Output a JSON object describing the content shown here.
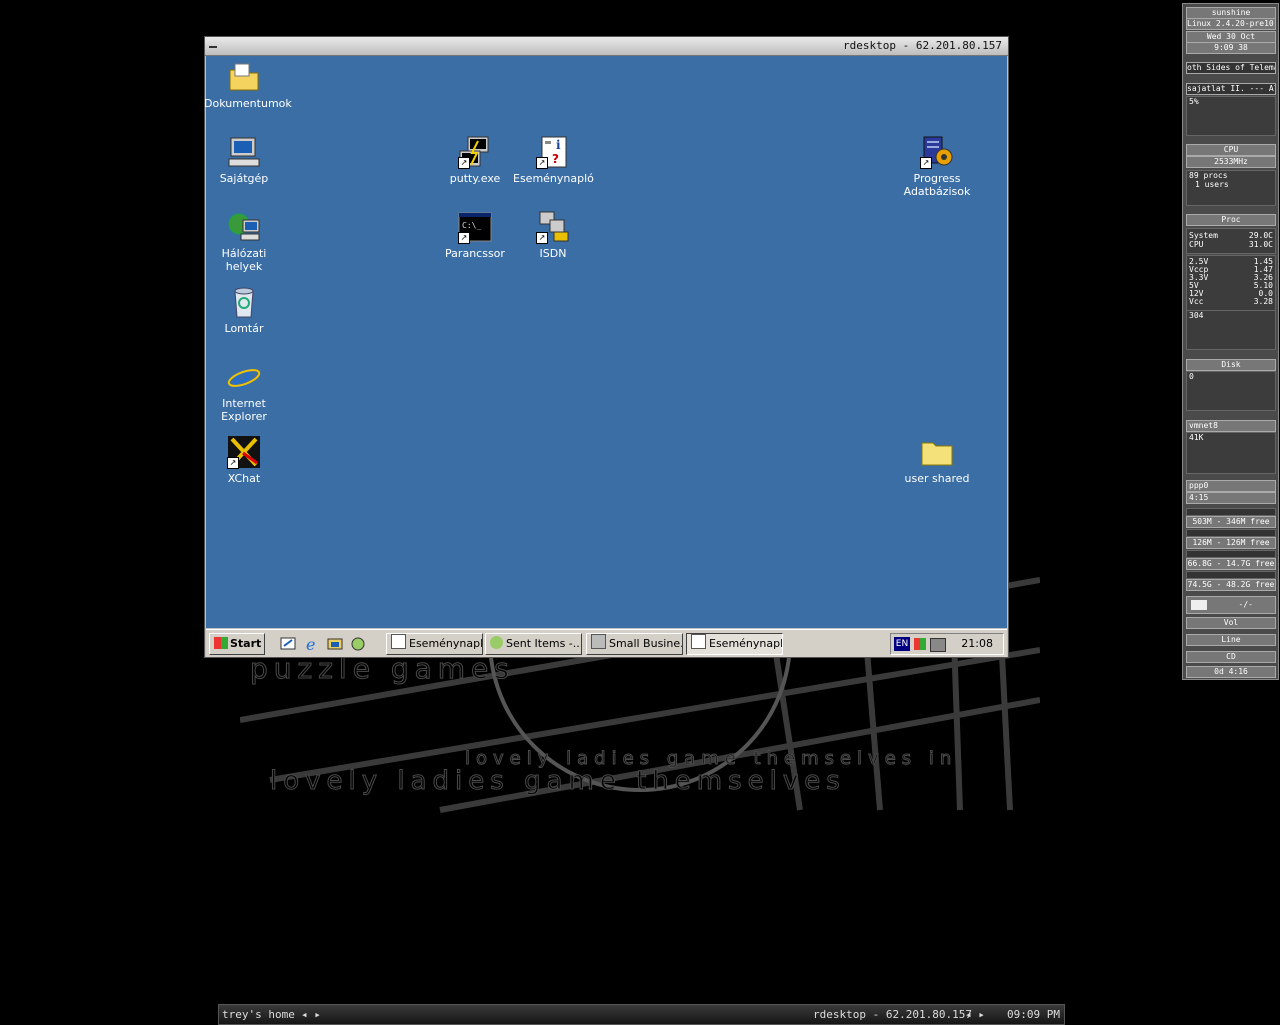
{
  "window": {
    "title": "rdesktop - 62.201.80.157"
  },
  "desktop_icons": [
    {
      "label": "Dokumentumok"
    },
    {
      "label": "Sajátgép"
    },
    {
      "label": "Hálózati helyek"
    },
    {
      "label": "Lomtár"
    },
    {
      "label": "Internet Explorer"
    },
    {
      "label": "XChat"
    },
    {
      "label": "putty.exe"
    },
    {
      "label": "Eseménynapló"
    },
    {
      "label": "Parancssor"
    },
    {
      "label": "ISDN"
    },
    {
      "label": "Progress Adatbázisok"
    },
    {
      "label": "user shared"
    }
  ],
  "taskbar": {
    "start_label": "Start",
    "tasks": [
      "Eseménynapló",
      "Sent Items -...",
      "Small Busine...",
      "Eseménynapló"
    ],
    "lang": "EN",
    "clock": "21:08"
  },
  "gkrellm": {
    "host": "sunshine",
    "kernel": "Linux 2.4.20-pre10-ac",
    "date": "Wed 30 Oct",
    "time": "9:09 38",
    "track1": "oth Sides of Telemarke",
    "track2": "sajatlat II. --- Allasajan",
    "cpu_pct": "5%",
    "cpu_label": "CPU",
    "cpu_mhz": "2533MHz",
    "procs": "89 procs",
    "users": "1 users",
    "proc_label": "Proc",
    "temps": [
      [
        "System",
        "29.0C"
      ],
      [
        "CPU",
        "31.0C"
      ]
    ],
    "volts": [
      [
        "2.5V",
        "1.45"
      ],
      [
        "Vccp",
        "1.47"
      ],
      [
        "3.3V",
        "3.26"
      ],
      [
        "5V",
        "5.10"
      ],
      [
        "12V",
        "0.0"
      ],
      [
        "Vcc",
        "3.28"
      ]
    ],
    "disk_val": "304",
    "disk_label": "Disk",
    "disk_zero": "0",
    "net1": "vmnet8",
    "net_val": "41K",
    "net2": "ppp0",
    "uptime_small": "4:15",
    "mem1": "503M - 346M free",
    "mem2": "126M - 126M free",
    "fs1": "66.8G - 14.7G free",
    "fs2": "74.5G - 48.2G free",
    "mail": "-/-",
    "vol": "Vol",
    "line": "Line",
    "cd": "CD",
    "uptime": "0d 4:16"
  },
  "bottom_bar": {
    "left": "trey's home",
    "center": "rdesktop - 62.201.80.157",
    "clock": "09:09 PM"
  },
  "wallpaper_text": [
    "puzzle games",
    "lovely ladies game themselves in",
    "lovely ladies game themselves"
  ]
}
